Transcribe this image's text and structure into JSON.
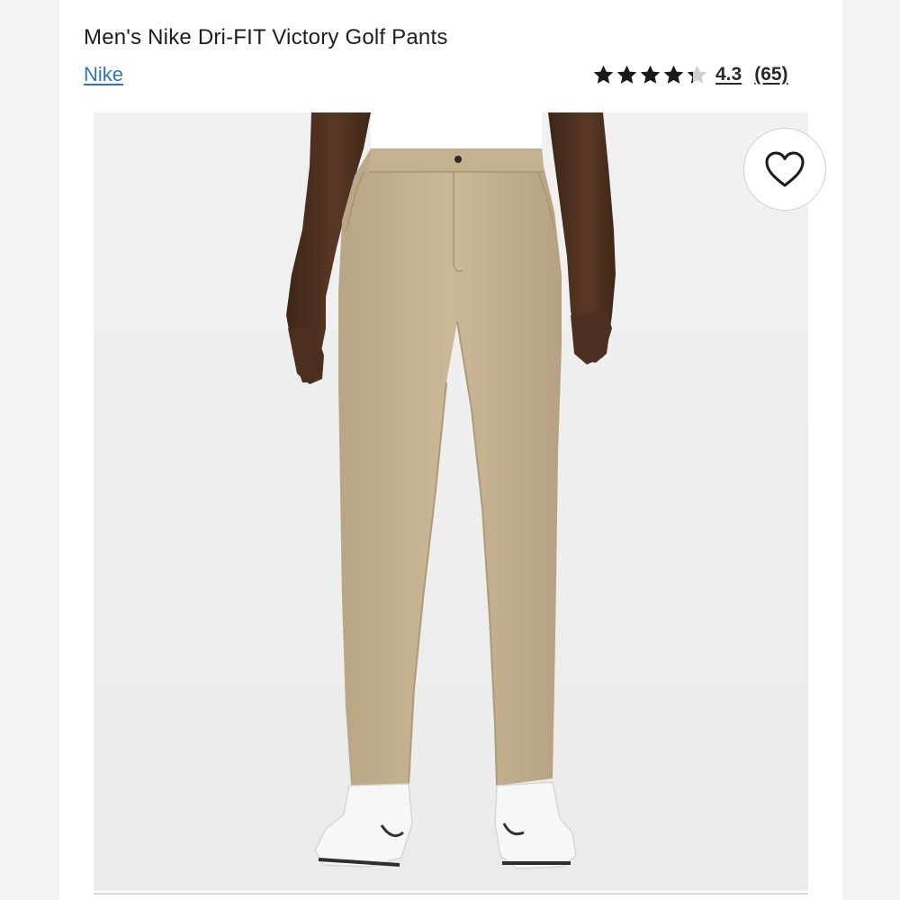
{
  "product": {
    "title": "Men's Nike Dri-FIT Victory Golf Pants",
    "brand": "Nike"
  },
  "rating": {
    "value": "4.3",
    "review_count": "(65)",
    "stars_filled": 4.3,
    "stars_total": 5,
    "star_color": "#1a1a1a",
    "star_empty_color": "#d0d0d0"
  },
  "image": {
    "alt": "Khaki golf pants worn by a model",
    "icon": "product-photo"
  },
  "favorite": {
    "icon": "heart-outline-icon"
  },
  "colors": {
    "brand_link": "#2f73c9",
    "pants": "#c9b697",
    "background": "#efefef"
  }
}
